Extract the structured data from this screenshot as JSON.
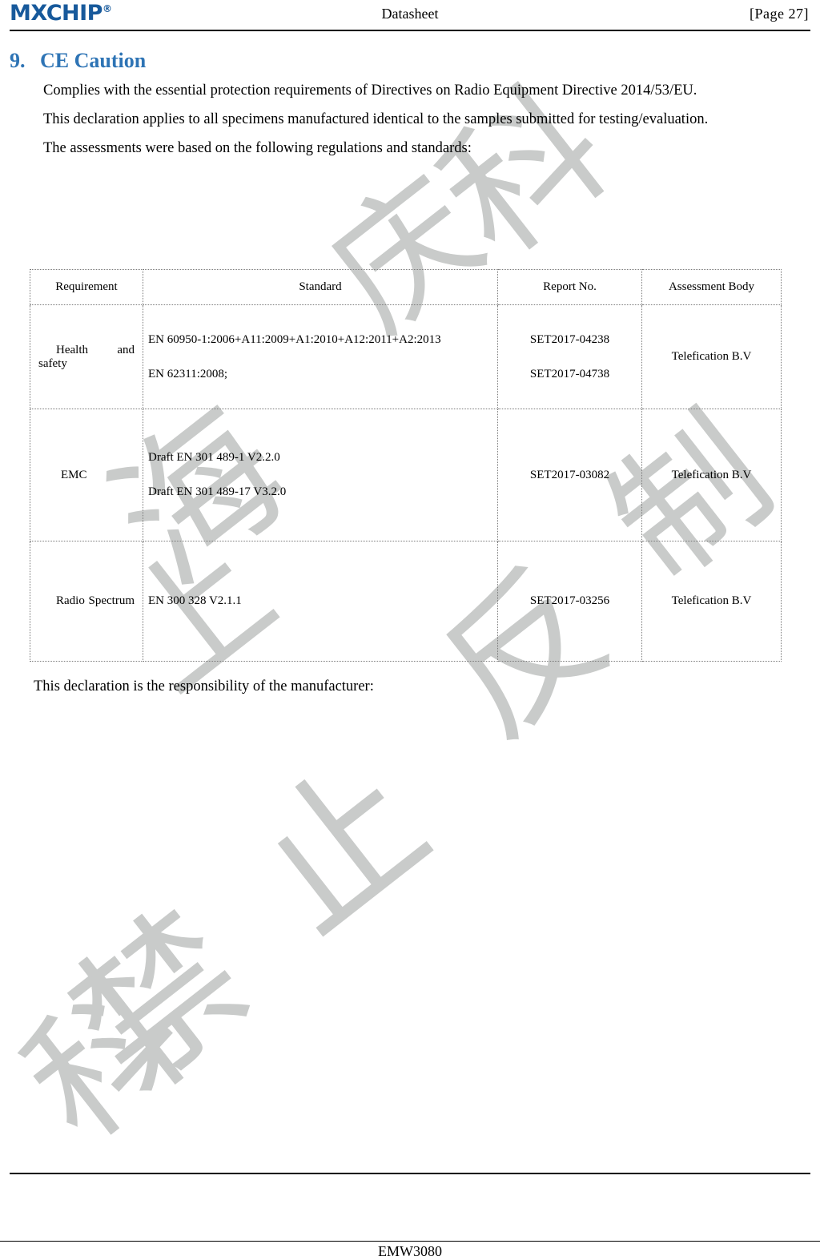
{
  "header": {
    "logo_text": "MXCHIP",
    "logo_registered": "®",
    "logo_color": "#17599b",
    "title": "Datasheet",
    "page_label": "[Page  27]"
  },
  "section": {
    "number": "9.",
    "title": "CE Caution",
    "title_color": "#2e74b5"
  },
  "paragraphs": {
    "p1": "Complies with the essential protection requirements of Directives on Radio Equipment Directive 2014/53/EU.",
    "p2": "This declaration applies to all specimens manufactured identical to the samples submitted for testing/evaluation.",
    "p3": "The assessments were based on the following regulations and standards:"
  },
  "table": {
    "headers": [
      "Requirement",
      "Standard",
      "Report No.",
      "Assessment Body"
    ],
    "rows": [
      {
        "requirement": "Health and safety",
        "standard_line1": "EN 60950-1:2006+A11:2009+A1:2010+A12:2011+A2:2013",
        "standard_line2": "EN 62311:2008;",
        "report_line1": "SET2017-04238",
        "report_line2": "SET2017-04738",
        "assessment_body": "Telefication B.V"
      },
      {
        "requirement": "EMC",
        "standard_line1": "Draft EN 301 489-1 V2.2.0",
        "standard_line2": "Draft EN 301 489-17 V3.2.0",
        "report_line1": "SET2017-03082",
        "report_line2": "",
        "assessment_body": "Telefication B.V"
      },
      {
        "requirement": "Radio Spectrum",
        "standard_line1": "EN 300 328 V2.1.1",
        "standard_line2": "",
        "report_line1": "SET2017-03256",
        "report_line2": "",
        "assessment_body": "Telefication B.V"
      }
    ]
  },
  "closing": {
    "text": "This declaration is the responsibility of the manufacturer:"
  },
  "footer": {
    "product": "EMW3080"
  },
  "watermark": {
    "color": "#c9cbca",
    "chars": [
      "上",
      "海",
      "庆",
      "科"
    ]
  }
}
